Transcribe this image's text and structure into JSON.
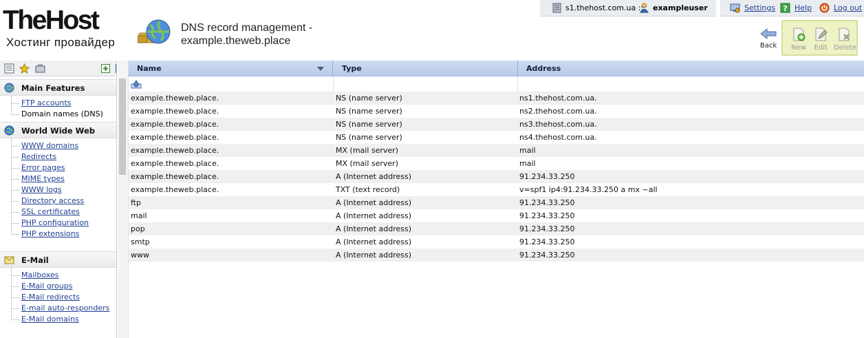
{
  "header": {
    "logo_main": "TheHost",
    "logo_sub": "Хостинг провайдер",
    "page_title": "DNS record management - example.theweb.place"
  },
  "topbar": {
    "server": "s1.thehost.com.ua ::",
    "user": "exampleuser",
    "settings": "Settings",
    "help": "Help",
    "logout": "Log out"
  },
  "toolbar": {
    "back": "Back",
    "new": "New",
    "edit": "Edit",
    "delete": "Delete"
  },
  "sidebar": {
    "sections": [
      {
        "title": "Main Features",
        "icon": "globe-icon",
        "items": [
          {
            "label": "FTP accounts",
            "link": true
          },
          {
            "label": "Domain names (DNS)",
            "link": false
          }
        ]
      },
      {
        "title": "World Wide Web",
        "icon": "www-icon",
        "items": [
          {
            "label": "WWW domains",
            "link": true
          },
          {
            "label": "Redirects",
            "link": true
          },
          {
            "label": "Error pages",
            "link": true
          },
          {
            "label": "MIME types",
            "link": true
          },
          {
            "label": "WWW logs",
            "link": true
          },
          {
            "label": "Directory access",
            "link": true
          },
          {
            "label": "SSL certificates",
            "link": true
          },
          {
            "label": "PHP configuration",
            "link": true
          },
          {
            "label": "PHP extensions",
            "link": true
          }
        ]
      },
      {
        "title": "E-Mail",
        "icon": "mail-icon",
        "items": [
          {
            "label": "Mailboxes",
            "link": true
          },
          {
            "label": "E-Mail groups",
            "link": true
          },
          {
            "label": "E-Mail redirects",
            "link": true
          },
          {
            "label": "E-mail auto-responders",
            "link": true
          },
          {
            "label": "E-Mail domains",
            "link": true
          }
        ]
      }
    ]
  },
  "table": {
    "columns": [
      "Name",
      "Type",
      "Address"
    ],
    "rows": [
      [
        "example.theweb.place.",
        "NS (name server)",
        "ns1.thehost.com.ua."
      ],
      [
        "example.theweb.place.",
        "NS (name server)",
        "ns2.thehost.com.ua."
      ],
      [
        "example.theweb.place.",
        "NS (name server)",
        "ns3.thehost.com.ua."
      ],
      [
        "example.theweb.place.",
        "NS (name server)",
        "ns4.thehost.com.ua."
      ],
      [
        "example.theweb.place.",
        "MX (mail server)",
        "mail"
      ],
      [
        "example.theweb.place.",
        "MX (mail server)",
        "mail"
      ],
      [
        "example.theweb.place.",
        "A (Internet address)",
        "91.234.33.250"
      ],
      [
        "example.theweb.place.",
        "TXT (text record)",
        "v=spf1 ip4:91.234.33.250 a mx ~all"
      ],
      [
        "ftp",
        "A (Internet address)",
        "91.234.33.250"
      ],
      [
        "mail",
        "A (Internet address)",
        "91.234.33.250"
      ],
      [
        "pop",
        "A (Internet address)",
        "91.234.33.250"
      ],
      [
        "smtp",
        "A (Internet address)",
        "91.234.33.250"
      ],
      [
        "www",
        "A (Internet address)",
        "91.234.33.250"
      ]
    ]
  },
  "colors": {
    "accent": "#1f3f92",
    "header_blue": "#c5d4ee",
    "toolbar_highlight": "#eef2c4"
  }
}
